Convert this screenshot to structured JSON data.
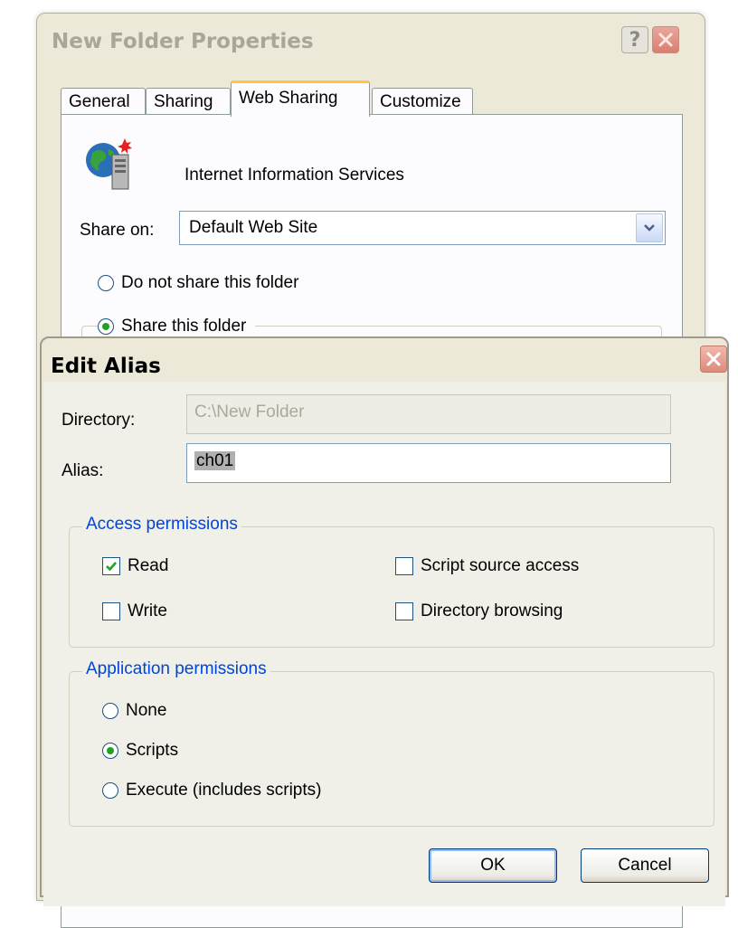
{
  "properties_window": {
    "title": "New Folder Properties",
    "tabs": [
      {
        "label": "General",
        "active": false
      },
      {
        "label": "Sharing",
        "active": false
      },
      {
        "label": "Web Sharing",
        "active": true
      },
      {
        "label": "Customize",
        "active": false
      }
    ],
    "service_label": "Internet Information Services",
    "share_on_label": "Share on:",
    "share_on_value": "Default Web Site",
    "radio_do_not_share": "Do not share this folder",
    "radio_share": "Share this folder",
    "selected_option": "Share this folder"
  },
  "edit_alias": {
    "title": "Edit Alias",
    "directory_label": "Directory:",
    "directory_value": "C:\\New Folder",
    "alias_label": "Alias:",
    "alias_value": "ch01",
    "access_permissions": {
      "legend": "Access permissions",
      "read": {
        "label": "Read",
        "checked": true
      },
      "write": {
        "label": "Write",
        "checked": false
      },
      "script_source": {
        "label": "Script source access",
        "checked": false
      },
      "directory_browsing": {
        "label": "Directory browsing",
        "checked": false
      }
    },
    "application_permissions": {
      "legend": "Application permissions",
      "options": [
        "None",
        "Scripts",
        "Execute (includes scripts)"
      ],
      "selected": "Scripts"
    },
    "ok_label": "OK",
    "cancel_label": "Cancel"
  },
  "colors": {
    "accent_tab": "#ffc83c",
    "legend_text": "#0046d5",
    "radio_dot": "#21a121",
    "close_button": "#dd8b7a"
  }
}
